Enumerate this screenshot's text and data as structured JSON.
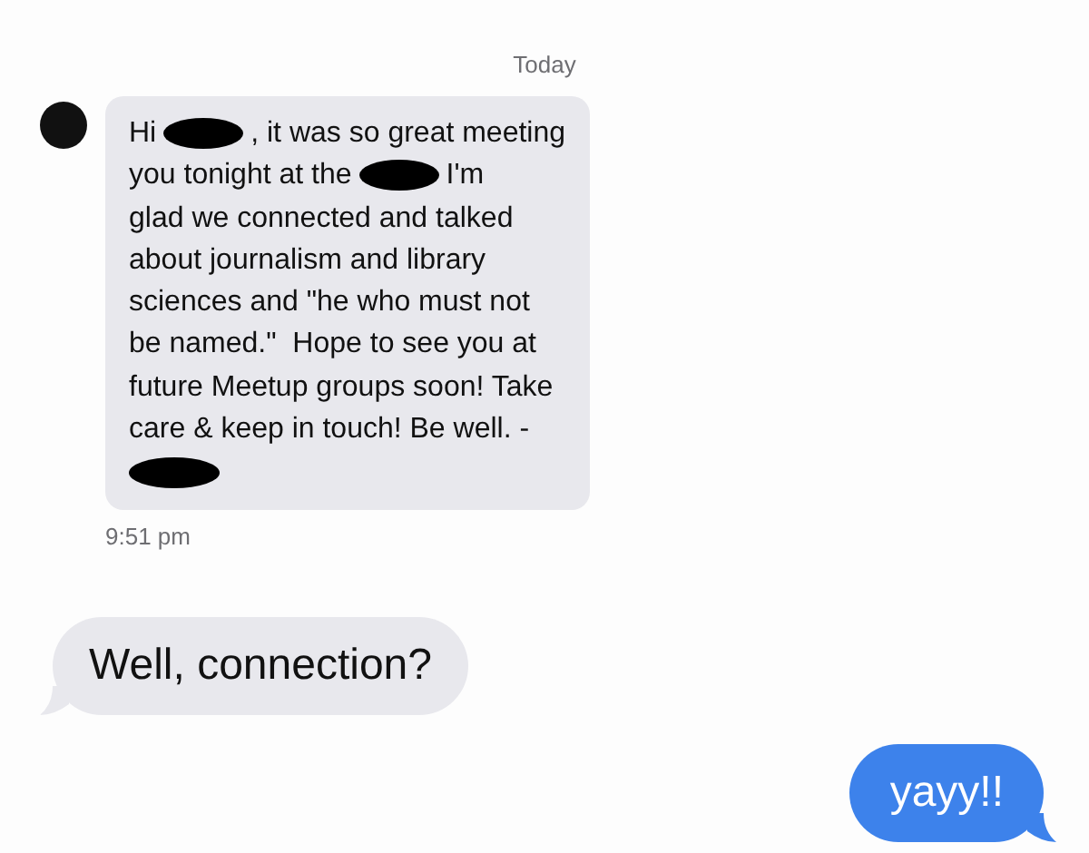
{
  "date_header": "Today",
  "messages": [
    {
      "kind": "incoming",
      "avatar": true,
      "lines": [
        [
          {
            "kind": "text",
            "text": "Hi"
          },
          {
            "kind": "redaction"
          },
          {
            "kind": "text",
            "text": ", it was so great meeting"
          }
        ],
        [
          {
            "kind": "text",
            "text": "you tonight at the"
          },
          {
            "kind": "redaction"
          },
          {
            "kind": "text",
            "text": "I'm"
          }
        ],
        [
          {
            "kind": "text",
            "text": "glad we connected and talked"
          }
        ],
        [
          {
            "kind": "text",
            "text": "about journalism and library"
          }
        ],
        [
          {
            "kind": "text",
            "text": "sciences and \"he who must not"
          }
        ],
        [
          {
            "kind": "text",
            "text": "be named.\"  Hope to see you at"
          }
        ],
        [
          {
            "kind": "text",
            "text": "future Meetup groups soon! Take"
          }
        ],
        [
          {
            "kind": "text",
            "text": "care & keep in touch! Be well. -"
          }
        ],
        [
          {
            "kind": "redaction"
          }
        ]
      ],
      "time": "9:51 pm"
    },
    {
      "kind": "incoming",
      "text": "Well, connection?"
    },
    {
      "kind": "outgoing",
      "text": "yayy!!"
    }
  ]
}
